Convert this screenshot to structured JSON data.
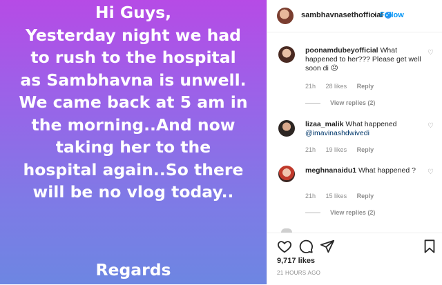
{
  "post": {
    "text_lines": "Hi Guys,\nYesterday night we had\nto rush to the hospital\nas Sambhavna is unwell.\nWe came back at 5 am in\nthe morning..And now\ntaking her to the\nhospital again..So  there\nwill be no vlog today..",
    "signoff": "Regards"
  },
  "header": {
    "username": "sambhavnasethofficial",
    "separator": "•",
    "follow_label": "Follow"
  },
  "comments": [
    {
      "user": "poonamdubeyofficial",
      "text": " What happened to her??? Please get well soon di ☹",
      "mention": "",
      "age": "21h",
      "likes": "28 likes",
      "reply": "Reply",
      "view_replies": "View replies (2)"
    },
    {
      "user": "lizaa_malik",
      "text": " What happened ",
      "mention": "@imavinashdwivedi",
      "age": "21h",
      "likes": "19 likes",
      "reply": "Reply",
      "view_replies": ""
    },
    {
      "user": "meghnanaidu1",
      "text": " What happened ?",
      "mention": "",
      "age": "21h",
      "likes": "15 likes",
      "reply": "Reply",
      "view_replies": "View replies (2)"
    }
  ],
  "footer": {
    "likes": "9,717 likes",
    "time": "21 HOURS AGO"
  },
  "icons": {
    "heart": "heart-icon",
    "comment": "comment-icon",
    "share": "share-icon",
    "bookmark": "bookmark-icon"
  },
  "colors": {
    "link_blue": "#0095f6",
    "verified_blue": "#3897f0",
    "gradient_top": "#b64be6",
    "gradient_bottom": "#6d86e2"
  }
}
